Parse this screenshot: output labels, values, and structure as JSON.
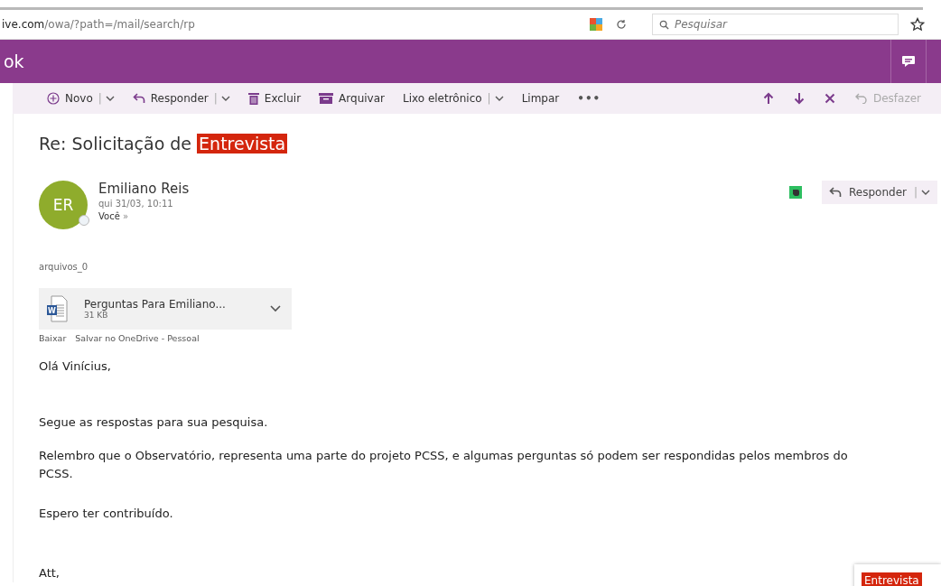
{
  "browser": {
    "url_host": "ive.com",
    "url_path": "/owa/?path=/mail/search/rp",
    "search": {
      "placeholder": "Pesquisar"
    }
  },
  "app": {
    "title": "ok"
  },
  "toolbar": [
    {
      "kind": "new",
      "label": "Novo",
      "dropdown": true
    },
    {
      "kind": "reply",
      "label": "Responder",
      "dropdown": true
    },
    {
      "kind": "delete",
      "label": "Excluir"
    },
    {
      "kind": "archive",
      "label": "Arquivar"
    },
    {
      "kind": "text",
      "label": "Lixo eletrônico",
      "dropdown": true
    },
    {
      "kind": "text",
      "label": "Limpar"
    },
    {
      "kind": "more",
      "label": "•••"
    }
  ],
  "toolbar_right": [
    {
      "kind": "up"
    },
    {
      "kind": "down"
    },
    {
      "kind": "close"
    },
    {
      "kind": "undo",
      "label": "Desfazer",
      "disabled": true
    }
  ],
  "separator": "|",
  "message": {
    "subject": "Re: Solicitação de ",
    "subject_highlight": "Entrevista",
    "avatar": "ER",
    "sender": "Emiliano Reis",
    "date": "qui 31/03, 10:11",
    "to": "Você",
    "to_expander": "»",
    "reply_button": "Responder",
    "attachment_group": "arquivos_0",
    "attachment": {
      "icon_letter": "W",
      "name": "Perguntas Para Emiliano...",
      "size": "31 KB"
    },
    "attachment_actions": [
      "Baixar",
      "Salvar no OneDrive - Pessoal"
    ],
    "body": [
      "Olá Vinícius,",
      "Segue as respostas para sua pesquisa.",
      "Relembro que o Observatório, representa uma parte do projeto PCSS, e algumas perguntas só podem ser respondidas pelos membros do PCSS.",
      "Espero ter contribuído.",
      "Att,"
    ]
  },
  "find_popup": {
    "highlight": "Entrevista"
  }
}
